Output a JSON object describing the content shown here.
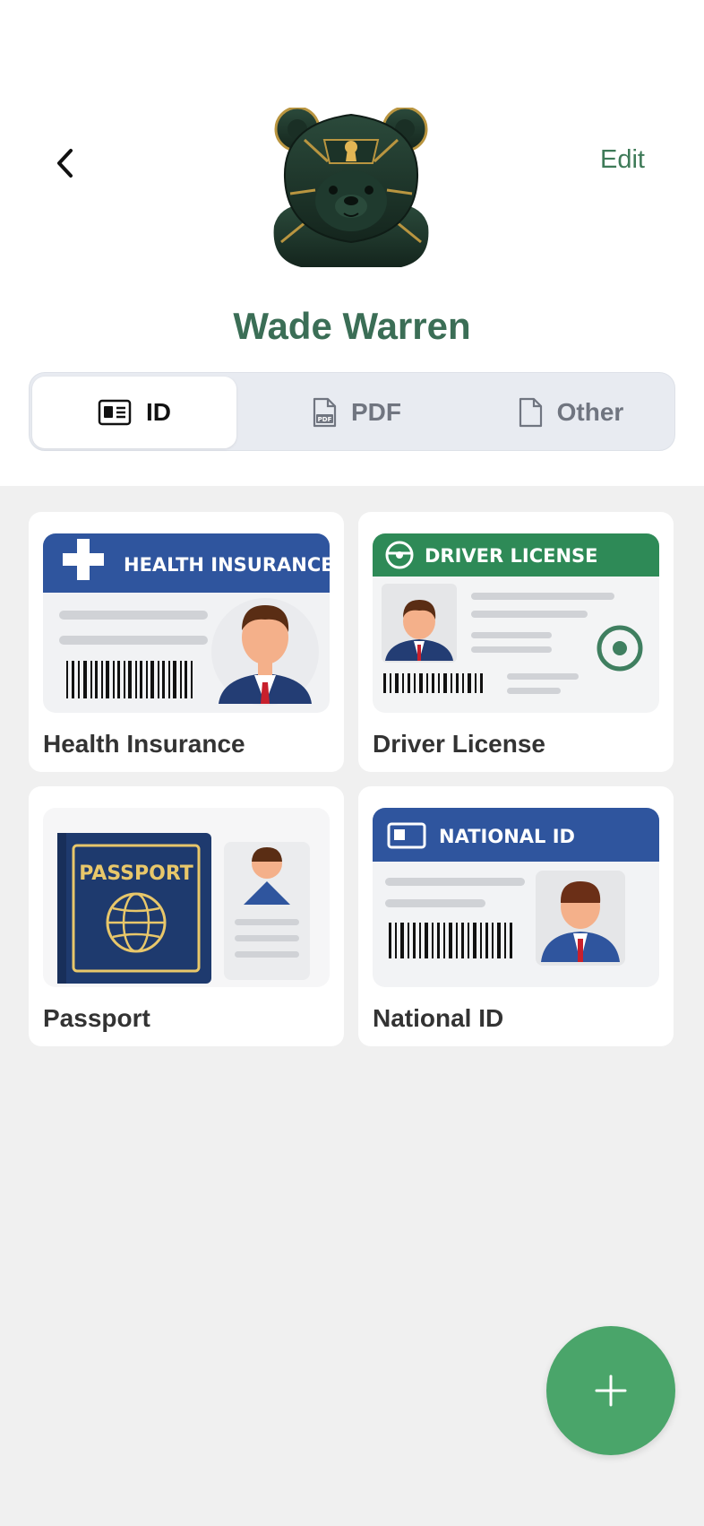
{
  "header": {
    "name": "Wade Warren",
    "edit_label": "Edit"
  },
  "tabs": [
    {
      "label": "ID",
      "icon": "id-card-icon",
      "active": true
    },
    {
      "label": "PDF",
      "icon": "pdf-file-icon",
      "active": false
    },
    {
      "label": "Other",
      "icon": "file-icon",
      "active": false
    }
  ],
  "documents": [
    {
      "label": "Health Insurance",
      "card_title": "HEALTH INSURANCE"
    },
    {
      "label": "Driver License",
      "card_title": "DRIVER LICENSE"
    },
    {
      "label": "Passport",
      "card_title": "PASSPORT"
    },
    {
      "label": "National ID",
      "card_title": "NATIONAL ID"
    }
  ],
  "colors": {
    "accent": "#3b6e56",
    "fab": "#4aa56a",
    "insurance_blue": "#2f559e",
    "license_green": "#2e8a57",
    "passport_navy": "#1e3a6e",
    "passport_gold": "#e8c76a"
  },
  "fab_icon": "plus-icon"
}
